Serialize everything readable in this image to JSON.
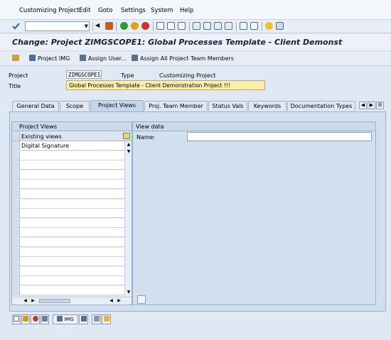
{
  "menu": [
    "Customizing Project",
    "Edit",
    "Goto",
    "Settings",
    "System",
    "Help"
  ],
  "command_field": {
    "value": ""
  },
  "title": "Change: Project ZIMGSCOPE1: Global Processes Template - Client Demonst",
  "app_toolbar": {
    "project_img": "Project IMG",
    "assign_user": "Assign User...",
    "assign_all": "Assign All Project Team Members"
  },
  "header": {
    "project_label": "Project",
    "project_value": "ZIMGSCOPE1",
    "type_label": "Type",
    "type_value": "Customizing Project",
    "title_label": "Title",
    "title_value": "Global Processes Template - Client Demonstration Project !!!"
  },
  "tabs": [
    "General Data",
    "Scope",
    "Project Views",
    "Proj. Team Member",
    "Status Vals",
    "Keywords",
    "Documentation Types"
  ],
  "active_tab": "Project Views",
  "project_views": {
    "header": "Project Views",
    "column": "Existing views",
    "rows": [
      "Digital Signature"
    ]
  },
  "view_data": {
    "header": "View data",
    "name_label": "Name:",
    "name_value": ""
  },
  "bottom_buttons": {
    "img": "IMG"
  },
  "colors": {
    "background": "#dfe8f3",
    "active_tab": "#c6d6ea",
    "required_field": "#ffeeaa"
  }
}
